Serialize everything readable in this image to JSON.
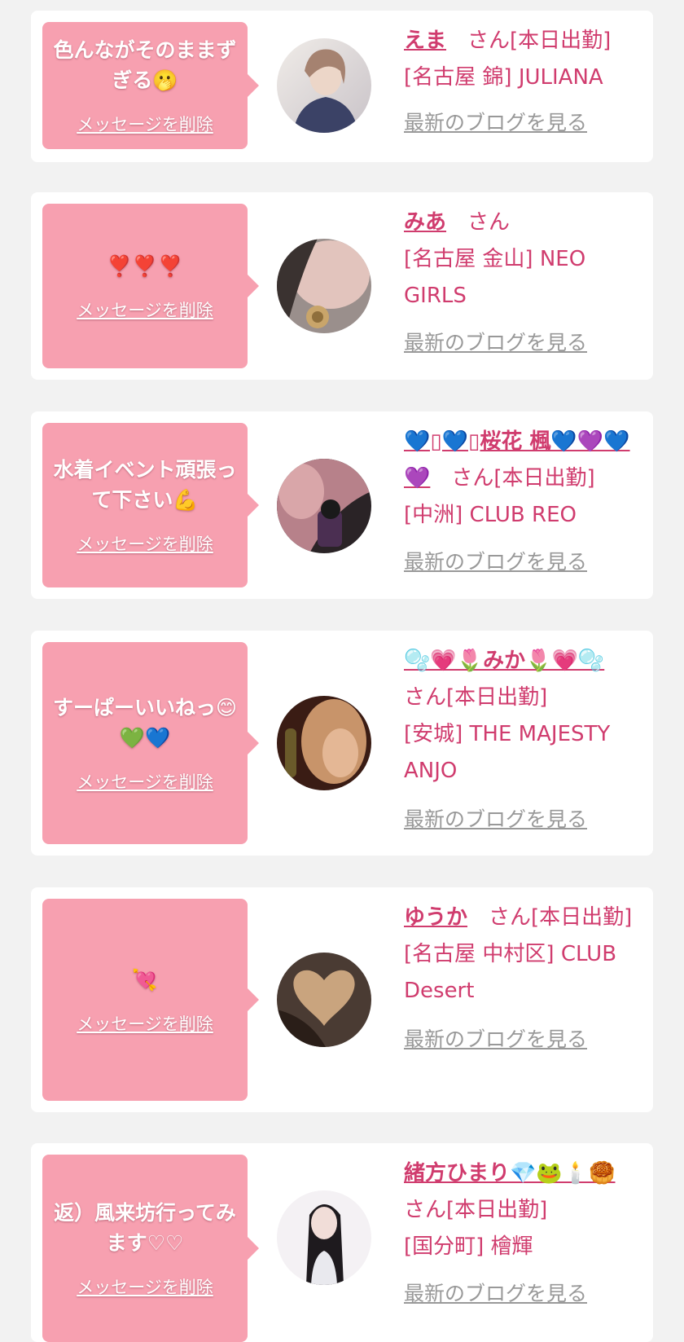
{
  "messages": [
    {
      "text": "色んながそのままずぎる🫢",
      "delete_label": "メッセージを削除",
      "name": "えま",
      "status": "さん[本日出勤]",
      "shop": "[名古屋 錦] JULIANA",
      "blog_label": "最新のブログを見る"
    },
    {
      "text": "❣️❣️❣️",
      "delete_label": "メッセージを削除",
      "name": "みあ",
      "status": "さん",
      "shop": "[名古屋 金山] NEO GIRLS",
      "blog_label": "最新のブログを見る"
    },
    {
      "text": "水着イベント頑張って下さい💪",
      "delete_label": "メッセージを削除",
      "name": "💙▯💙▯桜花 楓💙💜💙💜",
      "status": "さん[本日出勤]",
      "shop": "[中洲] CLUB REO",
      "blog_label": "最新のブログを見る"
    },
    {
      "text": "すーぱーいいねっ😊💚💙",
      "delete_label": "メッセージを削除",
      "name": "🫧💗🌷みか🌷💗🫧",
      "status": "さん[本日出勤]",
      "shop": "[安城] THE MAJESTY ANJO",
      "blog_label": "最新のブログを見る"
    },
    {
      "text": "💘",
      "delete_label": "メッセージを削除",
      "name": "ゆうか",
      "status": "さん[本日出勤]",
      "shop": "[名古屋 中村区] CLUB Desert",
      "blog_label": "最新のブログを見る"
    },
    {
      "text": "返）風来坊行ってみます♡♡",
      "delete_label": "メッセージを削除",
      "name": "緒方ひまり💎🐸🕯️🥮",
      "status": "さん[本日出勤]",
      "shop": "[国分町] 檜輝",
      "blog_label": "最新のブログを見る"
    }
  ]
}
